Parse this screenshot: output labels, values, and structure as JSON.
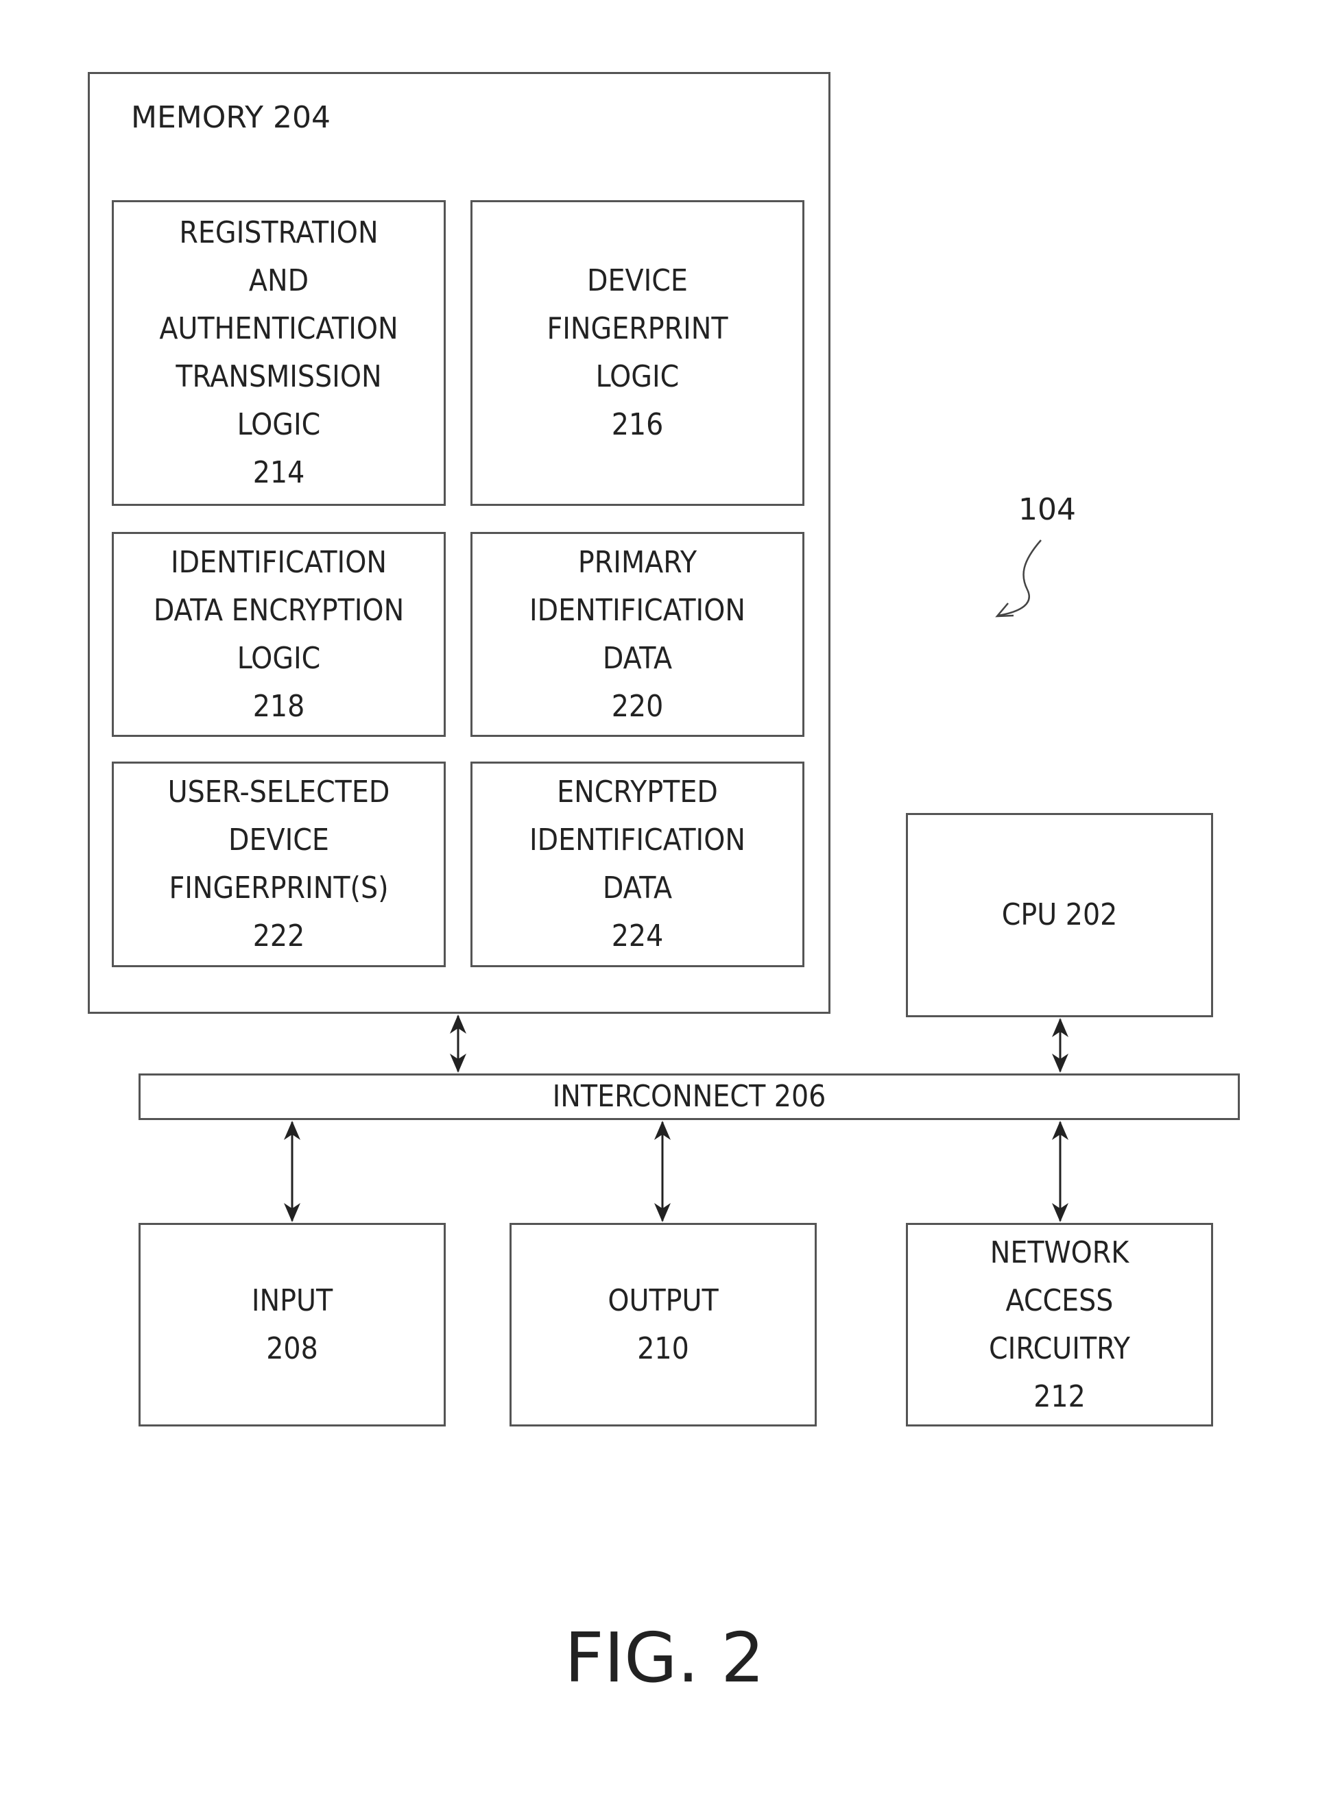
{
  "figure": {
    "label": "FIG. 2",
    "reference": "104"
  },
  "memory": {
    "label": "MEMORY 204",
    "blocks": [
      {
        "id": "214",
        "text": "REGISTRATION\nAND\nAUTHENTICATION\nTRANSMISSION\nLOGIC\n214"
      },
      {
        "id": "216",
        "text": "DEVICE\nFINGERPRINT\nLOGIC\n216"
      },
      {
        "id": "218",
        "text": "IDENTIFICATION\nDATA ENCRYPTION\nLOGIC\n218"
      },
      {
        "id": "220",
        "text": "PRIMARY\nIDENTIFICATION\nDATA\n220"
      },
      {
        "id": "222",
        "text": "USER-SELECTED\nDEVICE\nFINGERPRINT(S)\n222"
      },
      {
        "id": "224",
        "text": "ENCRYPTED\nIDENTIFICATION\nDATA\n224"
      }
    ]
  },
  "cpu": {
    "label": "CPU 202"
  },
  "interconnect": {
    "label": "INTERCONNECT 206"
  },
  "peripherals": [
    {
      "id": "208",
      "text": "INPUT\n208"
    },
    {
      "id": "210",
      "text": "OUTPUT\n210"
    },
    {
      "id": "212",
      "text": "NETWORK\nACCESS\nCIRCUITRY\n212"
    }
  ]
}
